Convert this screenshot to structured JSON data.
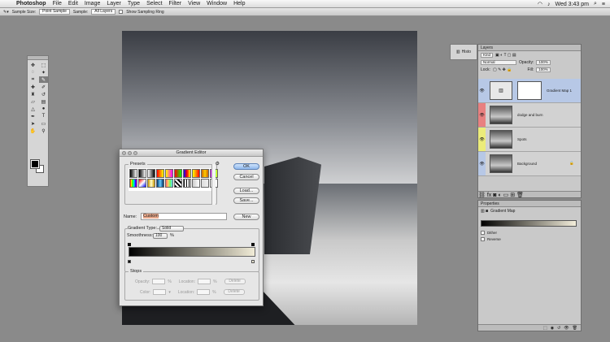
{
  "menubar": {
    "app": "Photoshop",
    "items": [
      "File",
      "Edit",
      "Image",
      "Layer",
      "Type",
      "Select",
      "Filter",
      "View",
      "Window",
      "Help"
    ],
    "clock": "Wed 3:43 pm"
  },
  "options": {
    "sample_size_label": "Sample Size:",
    "sample_size_value": "Point Sample",
    "sample_label": "Sample:",
    "sample_value": "All Layers",
    "sampling_ring_label": "Show Sampling Ring"
  },
  "mini_panel": {
    "label": "Histo"
  },
  "layers": {
    "tab": "Layers",
    "kind_label": "Kind",
    "blend_mode": "Normal",
    "opacity_label": "Opacity:",
    "opacity_value": "100%",
    "lock_label": "Lock:",
    "fill_label": "Fill:",
    "fill_value": "100%",
    "list": [
      {
        "name": "Gradient Map 1",
        "selected": true,
        "color": "#b7c8e6"
      },
      {
        "name": "dodge and burn",
        "selected": false,
        "color": "#e88080"
      },
      {
        "name": "Spots",
        "selected": false,
        "color": "#ecec7a"
      },
      {
        "name": "Background",
        "selected": false,
        "color": "#b7c8e6"
      }
    ]
  },
  "properties": {
    "tab": "Properties",
    "title": "Gradient Map",
    "options": [
      "Dither",
      "Reverse"
    ]
  },
  "dialog": {
    "title": "Gradient Editor",
    "presets_label": "Presets",
    "buttons": {
      "ok": "OK",
      "cancel": "Cancel",
      "load": "Load...",
      "save": "Save...",
      "new": "New"
    },
    "name_label": "Name:",
    "name_value": "Custom",
    "gradient_type_label": "Gradient Type:",
    "gradient_type_value": "Solid",
    "smoothness_label": "Smoothness:",
    "smoothness_value": "100",
    "smoothness_unit": "%",
    "stops_label": "Stops",
    "opacity_label": "Opacity:",
    "color_label": "Color:",
    "location_label": "Location:",
    "percent": "%",
    "delete_label": "Delete",
    "gradient_colors": [
      "#000000",
      "#f1ecd7"
    ],
    "preset_swatches": [
      "linear-gradient(90deg,#000,#fff)",
      "linear-gradient(90deg,#000,transparent)",
      "linear-gradient(90deg,#fff,#000)",
      "linear-gradient(90deg,#f00,#ff0)",
      "linear-gradient(90deg,#ff0,#f0f)",
      "linear-gradient(90deg,#f00,#0f0)",
      "linear-gradient(90deg,#00f,#f00,#ff0)",
      "linear-gradient(90deg,#ff0,#f80,#f00)",
      "linear-gradient(90deg,#c60,#fc0,#c60)",
      "linear-gradient(90deg,#f0f,#0ff,#ff0)",
      "linear-gradient(90deg,#f00,#ff0,#0f0,#0ff,#00f,#f0f)",
      "linear-gradient(135deg,#f00,#fff,#00f)",
      "linear-gradient(90deg,#c90,#ffc,#c90)",
      "linear-gradient(90deg,#036,#6cf,#036)",
      "linear-gradient(90deg,#f66,#fc6,#6f6,#6cf)",
      "repeating-linear-gradient(45deg,#000 0 2px,#fff 2px 4px)",
      "repeating-linear-gradient(90deg,#000 0 1px,#fff 1px 3px)",
      "linear-gradient(90deg,#ccc,#fff)",
      "linear-gradient(90deg,#ddd,#eee)",
      "linear-gradient(90deg,#eee,#fff)"
    ]
  }
}
